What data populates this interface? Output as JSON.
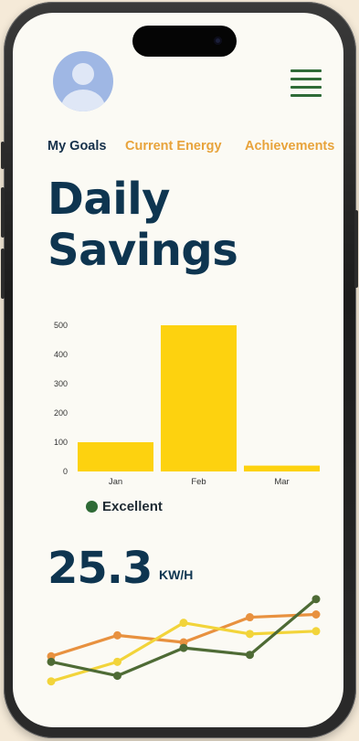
{
  "tabs": [
    {
      "label": "My Goals",
      "active": true
    },
    {
      "label": "Current Energy",
      "active": false
    },
    {
      "label": "Achievements",
      "active": false
    }
  ],
  "page_title_line1": "Daily",
  "page_title_line2": "Savings",
  "chart_data": {
    "type": "bar",
    "categories": [
      "Jan",
      "Feb",
      "Mar"
    ],
    "values": [
      100,
      500,
      20
    ],
    "ylim": [
      0,
      500
    ],
    "yticks": [
      0,
      100,
      200,
      300,
      400,
      500
    ],
    "color": "#fdd20f"
  },
  "legend": {
    "label": "Excellent",
    "color": "#2e6a36"
  },
  "energy": {
    "value": "25.3",
    "unit": "KW/H"
  },
  "trend_chart": {
    "type": "line",
    "x": [
      0,
      1,
      2,
      3,
      4
    ],
    "series": [
      {
        "color": "#e8913f",
        "values": [
          3.0,
          4.5,
          4.0,
          5.8,
          6.0
        ]
      },
      {
        "color": "#f2d43a",
        "values": [
          1.2,
          2.6,
          5.4,
          4.6,
          4.8
        ]
      },
      {
        "color": "#4e6b35",
        "values": [
          2.6,
          1.6,
          3.6,
          3.1,
          7.1
        ]
      }
    ],
    "ylim": [
      0,
      8
    ]
  },
  "colors": {
    "accent": "#e8a33b",
    "primary": "#0e3550",
    "menu": "#2f6b37"
  }
}
